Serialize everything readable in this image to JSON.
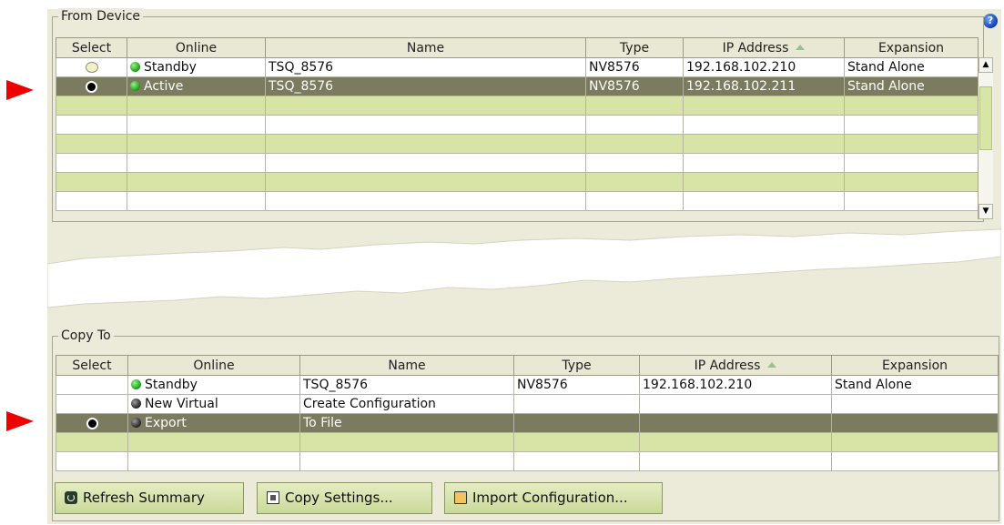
{
  "from_device": {
    "group_label": "From Device",
    "help_icon": "?",
    "columns": [
      "Select",
      "Online",
      "Name",
      "Type",
      "IP Address",
      "Expansion"
    ],
    "rows": [
      {
        "select": "unselected",
        "online": "Standby",
        "status": "green",
        "name": "TSQ_8576",
        "type": "NV8576",
        "ip": "192.168.102.210",
        "expansion": "Stand Alone"
      },
      {
        "select": "selected",
        "online": "Active",
        "status": "green",
        "name": "TSQ_8576",
        "type": "NV8576",
        "ip": "192.168.102.211",
        "expansion": "Stand Alone"
      }
    ],
    "empty_rows": 6
  },
  "copy_to": {
    "group_label": "Copy To",
    "columns": [
      "Select",
      "Online",
      "Name",
      "Type",
      "IP Address",
      "Expansion"
    ],
    "rows": [
      {
        "select": "none",
        "online": "Standby",
        "status": "green",
        "name": "TSQ_8576",
        "type": "NV8576",
        "ip": "192.168.102.210",
        "expansion": "Stand Alone"
      },
      {
        "select": "none",
        "online": "New Virtual",
        "status": "dark",
        "name": "Create Configuration",
        "type": "",
        "ip": "",
        "expansion": ""
      },
      {
        "select": "selected",
        "online": "Export",
        "status": "dark",
        "name": "To File",
        "type": "",
        "ip": "",
        "expansion": ""
      }
    ],
    "empty_rows": 2
  },
  "buttons": {
    "refresh": "Refresh Summary",
    "copy": "Copy Settings...",
    "import": "Import Configuration..."
  },
  "colors": {
    "selected_row": "#7a7b5f",
    "alt_row": "#d8e4a6",
    "marker": "#ee0000",
    "status_green": "#1a9a1a"
  }
}
